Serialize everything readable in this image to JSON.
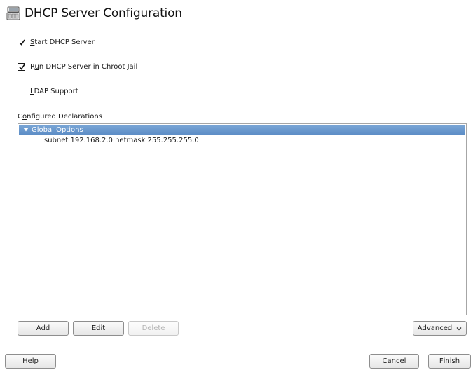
{
  "window": {
    "title": "DHCP Server Configuration",
    "icon": "server-settings-icon"
  },
  "options": [
    {
      "label_pre": "",
      "mnemonic": "S",
      "label_post": "tart DHCP Server",
      "checked": true
    },
    {
      "label_pre": "R",
      "mnemonic": "u",
      "label_post": "n DHCP Server in Chroot Jail",
      "checked": true
    },
    {
      "label_pre": "",
      "mnemonic": "L",
      "label_post": "DAP Support",
      "checked": false
    }
  ],
  "declarations": {
    "label_pre": "C",
    "label_mnemonic": "o",
    "label_post": "nfigured Declarations",
    "root": "Global Options",
    "children": [
      "subnet 192.168.2.0 netmask 255.255.255.0"
    ],
    "selected_color": "#6b98cd"
  },
  "actions": {
    "add": {
      "pre": "",
      "mn": "A",
      "post": "dd"
    },
    "edit": {
      "pre": "Ed",
      "mn": "i",
      "post": "t"
    },
    "delete": {
      "pre": "Dele",
      "mn": "t",
      "post": "e"
    },
    "advanced": {
      "pre": "Ad",
      "mn": "v",
      "post": "anced"
    }
  },
  "footer": {
    "help": "Help",
    "cancel": {
      "pre": "",
      "mn": "C",
      "post": "ancel"
    },
    "finish": {
      "pre": "",
      "mn": "F",
      "post": "inish"
    }
  }
}
